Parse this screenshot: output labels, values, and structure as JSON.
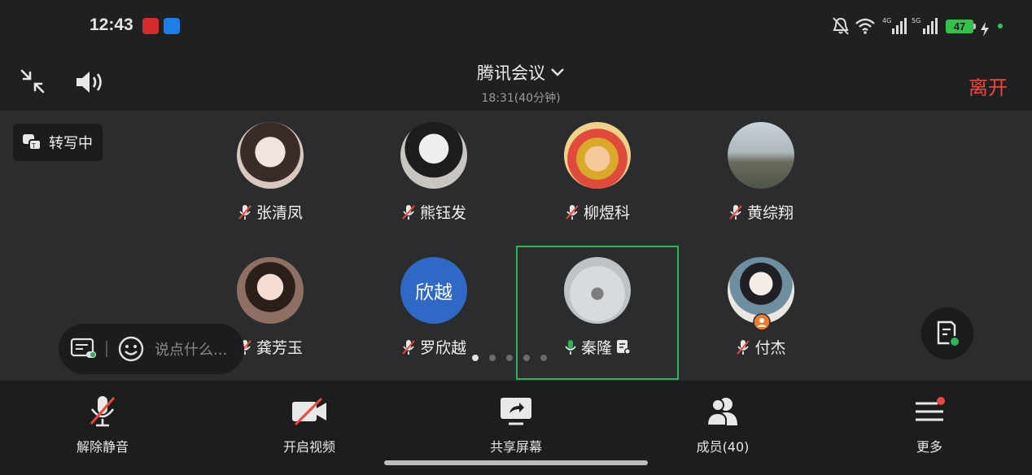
{
  "status_bar": {
    "time": "12:43",
    "battery": "47",
    "icons": [
      "bell-off-icon",
      "wifi-icon",
      "signal-4g-icon",
      "signal-5g-icon",
      "charging-icon"
    ]
  },
  "header": {
    "title": "腾讯会议",
    "duration": "18:31(40分钟)",
    "leave_label": "离开"
  },
  "transcription": {
    "label": "转写中"
  },
  "participants": [
    {
      "name": "张清凤",
      "mic": "muted"
    },
    {
      "name": "熊钰发",
      "mic": "muted"
    },
    {
      "name": "柳煜科",
      "mic": "muted"
    },
    {
      "name": "黄综翔",
      "mic": "muted"
    },
    {
      "name": "龚芳玉",
      "mic": "muted"
    },
    {
      "name": "罗欣越",
      "mic": "muted",
      "avatar_text": "欣越"
    },
    {
      "name": "秦隆",
      "mic": "on",
      "speaking": true
    },
    {
      "name": "付杰",
      "mic": "muted",
      "host": true
    }
  ],
  "chat": {
    "placeholder": "说点什么..."
  },
  "pagination": {
    "pages": 5,
    "current": 1
  },
  "toolbar": {
    "unmute": "解除静音",
    "video": "开启视频",
    "share": "共享屏幕",
    "members": "成员(40)",
    "more": "更多"
  },
  "colors": {
    "leave": "#f0453c",
    "active_border": "#2fb45a",
    "battery": "#34c04a",
    "badge": "#f0453c"
  }
}
